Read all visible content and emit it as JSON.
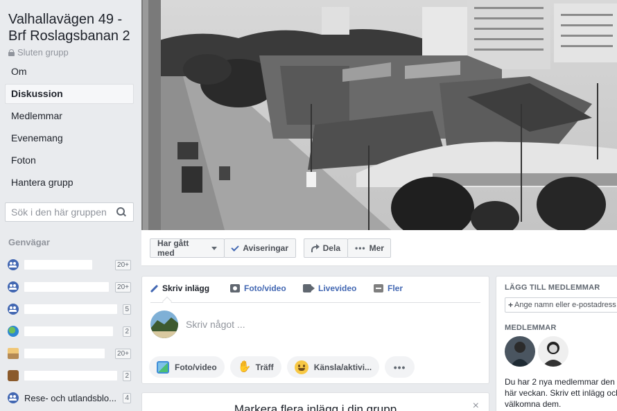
{
  "group": {
    "title": "Valhallavägen 49 - Brf Roslagsbanan 2",
    "privacy": "Sluten grupp"
  },
  "nav": {
    "items": [
      {
        "label": "Om"
      },
      {
        "label": "Diskussion",
        "active": true
      },
      {
        "label": "Medlemmar"
      },
      {
        "label": "Evenemang"
      },
      {
        "label": "Foton"
      },
      {
        "label": "Hantera grupp"
      }
    ]
  },
  "search": {
    "placeholder": "Sök i den här gruppen",
    "icon": "search-icon"
  },
  "shortcuts": {
    "heading": "Genvägar",
    "items": [
      {
        "icon": "group-icon",
        "label": "",
        "count": "20+"
      },
      {
        "icon": "group-icon",
        "label": "",
        "count": "20+"
      },
      {
        "icon": "group-icon",
        "label": "",
        "count": "5"
      },
      {
        "icon": "globe-icon",
        "label": "",
        "count": "2"
      },
      {
        "icon": "photo-icon",
        "label": "",
        "count": "20+"
      },
      {
        "icon": "bag-icon",
        "label": "",
        "count": "2"
      },
      {
        "icon": "group-icon",
        "label": "Rese- och utlandsblo...",
        "count": "4"
      }
    ]
  },
  "actions": {
    "joined": "Har gått med",
    "notifications": "Aviseringar",
    "share": "Dela",
    "more": "Mer"
  },
  "composer": {
    "tabs": [
      "Skriv inlägg",
      "Foto/video",
      "Livevideo",
      "Fler"
    ],
    "placeholder": "Skriv något ...",
    "buttons": [
      "Foto/video",
      "Träff",
      "Känsla/aktivi..."
    ],
    "more": "•••"
  },
  "feature_card": {
    "title": "Markera flera inlägg i din grupp",
    "close": "×"
  },
  "right_panel": {
    "add_members_heading": "LÄGG TILL MEDLEMMAR",
    "add_members_placeholder": "Ange namn eller e-postadress",
    "members_heading": "MEDLEMMAR",
    "new_members_text": "Du har 2 nya medlemmar den här veckan. Skriv ett inlägg och välkomna dem."
  },
  "colors": {
    "accent": "#4267b2",
    "background": "#e9ebee",
    "text": "#1d2129",
    "muted": "#90949c"
  }
}
